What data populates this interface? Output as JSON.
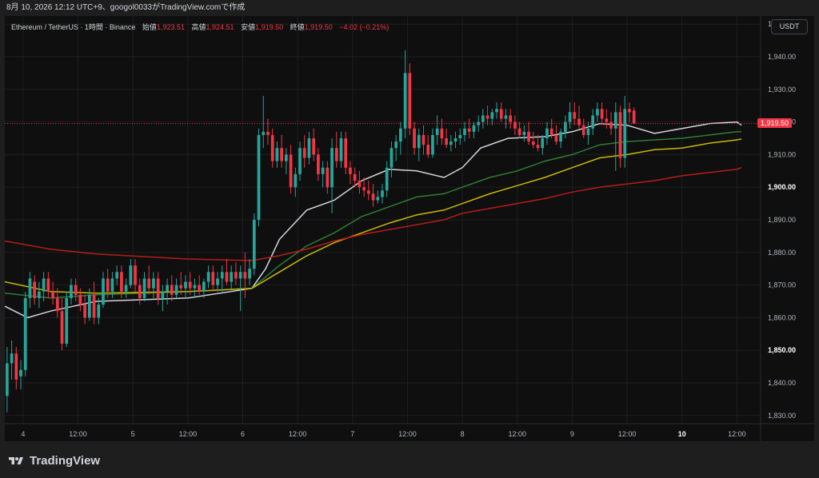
{
  "header": {
    "caption": "8月 10, 2026 12:12 UTC+9、googol0033がTradingView.comで作成"
  },
  "legend": {
    "symbol": "Ethereum / TetherUS · 1時間 · Binance",
    "open_label": "始値",
    "open_value": "1,923.51",
    "high_label": "高値",
    "high_value": "1,924.51",
    "low_label": "安値",
    "low_value": "1,919.50",
    "close_label": "終値",
    "close_value": "1,919.50",
    "change": "−4.02 (−0.21%)"
  },
  "currency_button": "USDT",
  "last_price_tag": "1,919.50",
  "brand": "TradingView",
  "colors": {
    "up": "#26a69a",
    "down": "#f23645",
    "ma_fast": "#d1d4dc",
    "ma_mid": "#2e7d32",
    "ma_slow": "#c9b800",
    "ma_long": "#b71c1c"
  },
  "chart_data": {
    "type": "candlestick",
    "y_tick_labels": [
      "1,950.00",
      "1,940.00",
      "1,930.00",
      "1,920.00",
      "1,910.00",
      "1,900.00",
      "1,890.00",
      "1,880.00",
      "1,870.00",
      "1,860.00",
      "1,850.00",
      "1,840.00",
      "1,830.00"
    ],
    "y_ticks": [
      1950,
      1940,
      1930,
      1920,
      1910,
      1900,
      1890,
      1880,
      1870,
      1860,
      1850,
      1840,
      1830
    ],
    "ylim": [
      1827.5,
      1952.5
    ],
    "x_tick_labels": [
      "4",
      "12:00",
      "5",
      "12:00",
      "6",
      "12:00",
      "7",
      "12:00",
      "8",
      "12:00",
      "9",
      "12:00",
      "10",
      "12:00"
    ],
    "x_ticks": [
      4,
      16,
      28,
      40,
      52,
      64,
      76,
      88,
      100,
      112,
      124,
      136,
      148,
      160
    ],
    "xlim": [
      0,
      165
    ],
    "last_price": 1919.5,
    "moving_averages": [
      {
        "color": "#d1d4dc",
        "points": [
          [
            0,
            1863.5
          ],
          [
            5,
            1860
          ],
          [
            10,
            1862
          ],
          [
            20,
            1865
          ],
          [
            40,
            1866
          ],
          [
            54,
            1869
          ],
          [
            57,
            1875
          ],
          [
            60,
            1884
          ],
          [
            66,
            1893
          ],
          [
            72,
            1896
          ],
          [
            78,
            1902
          ],
          [
            84,
            1905.5
          ],
          [
            90,
            1905
          ],
          [
            96,
            1903
          ],
          [
            100,
            1906
          ],
          [
            104,
            1912
          ],
          [
            110,
            1915
          ],
          [
            118,
            1915.5
          ],
          [
            124,
            1917
          ],
          [
            130,
            1919.5
          ],
          [
            136,
            1919
          ],
          [
            142,
            1916.5
          ],
          [
            148,
            1918
          ],
          [
            154,
            1919.5
          ],
          [
            160,
            1920
          ],
          [
            161,
            1919
          ]
        ]
      },
      {
        "color": "#2e7d32",
        "points": [
          [
            0,
            1867.5
          ],
          [
            10,
            1866
          ],
          [
            20,
            1867
          ],
          [
            40,
            1868
          ],
          [
            54,
            1869
          ],
          [
            60,
            1876
          ],
          [
            66,
            1882
          ],
          [
            72,
            1886
          ],
          [
            78,
            1891
          ],
          [
            84,
            1894
          ],
          [
            90,
            1897
          ],
          [
            96,
            1898
          ],
          [
            100,
            1900
          ],
          [
            106,
            1903
          ],
          [
            112,
            1905
          ],
          [
            118,
            1908
          ],
          [
            124,
            1910
          ],
          [
            130,
            1913
          ],
          [
            136,
            1914
          ],
          [
            142,
            1914.5
          ],
          [
            148,
            1915
          ],
          [
            154,
            1916
          ],
          [
            160,
            1917
          ],
          [
            161,
            1917
          ]
        ]
      },
      {
        "color": "#c9b800",
        "points": [
          [
            0,
            1871
          ],
          [
            10,
            1868
          ],
          [
            20,
            1867.5
          ],
          [
            40,
            1868
          ],
          [
            54,
            1869
          ],
          [
            60,
            1874
          ],
          [
            66,
            1879
          ],
          [
            72,
            1883
          ],
          [
            78,
            1886
          ],
          [
            84,
            1889
          ],
          [
            90,
            1891.5
          ],
          [
            96,
            1893
          ],
          [
            100,
            1895
          ],
          [
            106,
            1898
          ],
          [
            112,
            1900.5
          ],
          [
            118,
            1903
          ],
          [
            124,
            1906
          ],
          [
            130,
            1909
          ],
          [
            136,
            1910
          ],
          [
            142,
            1911.5
          ],
          [
            148,
            1912
          ],
          [
            154,
            1913.5
          ],
          [
            160,
            1914.5
          ],
          [
            161,
            1914.8
          ]
        ]
      },
      {
        "color": "#b71c1c",
        "points": [
          [
            0,
            1883.5
          ],
          [
            10,
            1881
          ],
          [
            20,
            1879.5
          ],
          [
            40,
            1878
          ],
          [
            54,
            1877.5
          ],
          [
            60,
            1879
          ],
          [
            66,
            1881
          ],
          [
            72,
            1883.5
          ],
          [
            78,
            1885.5
          ],
          [
            84,
            1887
          ],
          [
            90,
            1888.5
          ],
          [
            96,
            1890
          ],
          [
            100,
            1892
          ],
          [
            106,
            1893.5
          ],
          [
            112,
            1895
          ],
          [
            118,
            1896.5
          ],
          [
            124,
            1898.5
          ],
          [
            130,
            1900
          ],
          [
            136,
            1901
          ],
          [
            142,
            1902
          ],
          [
            148,
            1903.5
          ],
          [
            154,
            1904.5
          ],
          [
            160,
            1905.5
          ],
          [
            161,
            1906
          ]
        ]
      }
    ],
    "candles": [
      [
        0,
        1836,
        1851,
        1831,
        1846
      ],
      [
        1,
        1846,
        1853,
        1841,
        1849
      ],
      [
        2,
        1849,
        1851,
        1838,
        1841
      ],
      [
        3,
        1842,
        1847,
        1838,
        1844
      ],
      [
        4,
        1844,
        1868,
        1842,
        1866
      ],
      [
        5,
        1866,
        1874,
        1863,
        1872
      ],
      [
        6,
        1871,
        1873,
        1864,
        1866
      ],
      [
        7,
        1866,
        1871,
        1863,
        1868
      ],
      [
        8,
        1868,
        1874,
        1865,
        1872
      ],
      [
        9,
        1872,
        1874,
        1866,
        1868
      ],
      [
        10,
        1868,
        1871,
        1864,
        1866
      ],
      [
        11,
        1866,
        1869,
        1860,
        1862
      ],
      [
        12,
        1862,
        1866,
        1850,
        1852
      ],
      [
        13,
        1852,
        1868,
        1851,
        1866
      ],
      [
        14,
        1866,
        1872,
        1864,
        1870
      ],
      [
        15,
        1870,
        1872,
        1865,
        1867
      ],
      [
        16,
        1867,
        1869,
        1862,
        1864
      ],
      [
        17,
        1864,
        1867,
        1858,
        1860
      ],
      [
        18,
        1860,
        1869,
        1859,
        1867
      ],
      [
        19,
        1867,
        1871,
        1858,
        1860
      ],
      [
        20,
        1860,
        1866,
        1858,
        1864
      ],
      [
        21,
        1864,
        1874,
        1863,
        1872
      ],
      [
        22,
        1872,
        1875,
        1866,
        1868
      ],
      [
        23,
        1868,
        1874,
        1866,
        1872
      ],
      [
        24,
        1872,
        1876,
        1870,
        1874
      ],
      [
        25,
        1874,
        1876,
        1866,
        1868
      ],
      [
        26,
        1868,
        1872,
        1866,
        1870
      ],
      [
        27,
        1870,
        1878,
        1869,
        1876
      ],
      [
        28,
        1876,
        1878,
        1868,
        1870
      ],
      [
        29,
        1870,
        1872,
        1864,
        1866
      ],
      [
        30,
        1866,
        1874,
        1865,
        1872
      ],
      [
        31,
        1872,
        1876,
        1867,
        1869
      ],
      [
        32,
        1869,
        1874,
        1866,
        1872
      ],
      [
        33,
        1872,
        1874,
        1864,
        1866
      ],
      [
        34,
        1866,
        1870,
        1862,
        1868
      ],
      [
        35,
        1868,
        1872,
        1864,
        1870
      ],
      [
        36,
        1870,
        1873,
        1865,
        1867
      ],
      [
        37,
        1867,
        1872,
        1866,
        1870
      ],
      [
        38,
        1870,
        1874,
        1867,
        1869
      ],
      [
        39,
        1869,
        1873,
        1866,
        1871
      ],
      [
        40,
        1871,
        1874,
        1867,
        1869
      ],
      [
        41,
        1869,
        1872,
        1866,
        1870
      ],
      [
        42,
        1870,
        1873,
        1867,
        1868
      ],
      [
        43,
        1868,
        1872,
        1866,
        1871
      ],
      [
        44,
        1871,
        1876,
        1869,
        1874
      ],
      [
        45,
        1874,
        1876,
        1868,
        1870
      ],
      [
        46,
        1870,
        1874,
        1868,
        1872
      ],
      [
        47,
        1872,
        1876,
        1868,
        1874
      ],
      [
        48,
        1874,
        1878,
        1870,
        1871
      ],
      [
        49,
        1871,
        1876,
        1868,
        1874
      ],
      [
        50,
        1874,
        1877,
        1870,
        1872
      ],
      [
        51,
        1872,
        1876,
        1862,
        1874
      ],
      [
        52,
        1874,
        1880,
        1866,
        1872
      ],
      [
        53,
        1872,
        1878,
        1870,
        1875
      ],
      [
        54,
        1875,
        1892,
        1873,
        1890
      ],
      [
        55,
        1890,
        1918,
        1888,
        1916
      ],
      [
        56,
        1916,
        1928,
        1912,
        1917
      ],
      [
        57,
        1917,
        1921,
        1913,
        1916
      ],
      [
        58,
        1916,
        1918,
        1906,
        1908
      ],
      [
        59,
        1908,
        1914,
        1906,
        1912
      ],
      [
        60,
        1912,
        1916,
        1906,
        1908
      ],
      [
        61,
        1908,
        1912,
        1904,
        1910
      ],
      [
        62,
        1910,
        1913,
        1898,
        1900
      ],
      [
        63,
        1900,
        1906,
        1897,
        1904
      ],
      [
        64,
        1904,
        1914,
        1902,
        1912
      ],
      [
        65,
        1912,
        1916,
        1906,
        1909
      ],
      [
        66,
        1909,
        1917,
        1907,
        1915
      ],
      [
        67,
        1915,
        1918,
        1908,
        1910
      ],
      [
        68,
        1910,
        1912,
        1902,
        1904
      ],
      [
        69,
        1904,
        1908,
        1900,
        1906
      ],
      [
        70,
        1906,
        1908,
        1898,
        1900
      ],
      [
        71,
        1900,
        1915,
        1892,
        1912
      ],
      [
        72,
        1912,
        1917,
        1906,
        1908
      ],
      [
        73,
        1908,
        1917,
        1906,
        1915
      ],
      [
        74,
        1915,
        1917,
        1904,
        1906
      ],
      [
        75,
        1906,
        1908,
        1901,
        1904
      ],
      [
        76,
        1904,
        1906,
        1900,
        1902
      ],
      [
        77,
        1902,
        1905,
        1898,
        1900
      ],
      [
        78,
        1900,
        1903,
        1897,
        1899
      ],
      [
        79,
        1899,
        1902,
        1896,
        1898
      ],
      [
        80,
        1898,
        1901,
        1894,
        1896
      ],
      [
        81,
        1896,
        1899,
        1895,
        1897
      ],
      [
        82,
        1897,
        1901,
        1895,
        1899
      ],
      [
        83,
        1899,
        1908,
        1897,
        1906
      ],
      [
        84,
        1906,
        1914,
        1903,
        1912
      ],
      [
        85,
        1912,
        1916,
        1908,
        1914
      ],
      [
        86,
        1914,
        1920,
        1910,
        1918
      ],
      [
        87,
        1918,
        1942,
        1915,
        1935
      ],
      [
        88,
        1935,
        1938,
        1916,
        1918
      ],
      [
        89,
        1918,
        1920,
        1910,
        1912
      ],
      [
        90,
        1912,
        1918,
        1908,
        1916
      ],
      [
        91,
        1916,
        1919,
        1910,
        1913
      ],
      [
        92,
        1913,
        1916,
        1909,
        1910
      ],
      [
        93,
        1910,
        1918,
        1909,
        1916
      ],
      [
        94,
        1916,
        1922,
        1913,
        1918
      ],
      [
        95,
        1918,
        1921,
        1913,
        1915
      ],
      [
        96,
        1915,
        1918,
        1912,
        1913
      ],
      [
        97,
        1913,
        1916,
        1911,
        1914
      ],
      [
        98,
        1914,
        1917,
        1912,
        1915
      ],
      [
        99,
        1915,
        1918,
        1913,
        1916
      ],
      [
        100,
        1916,
        1920,
        1914,
        1918
      ],
      [
        101,
        1918,
        1921,
        1915,
        1917
      ],
      [
        102,
        1917,
        1920,
        1915,
        1919
      ],
      [
        103,
        1919,
        1922,
        1917,
        1920
      ],
      [
        104,
        1920,
        1924,
        1918,
        1922
      ],
      [
        105,
        1922,
        1925,
        1919,
        1921
      ],
      [
        106,
        1921,
        1924,
        1919,
        1923
      ],
      [
        107,
        1923,
        1926,
        1921,
        1924
      ],
      [
        108,
        1924,
        1926,
        1920,
        1921
      ],
      [
        109,
        1921,
        1924,
        1918,
        1922
      ],
      [
        110,
        1922,
        1924,
        1918,
        1920
      ],
      [
        111,
        1920,
        1922,
        1916,
        1918
      ],
      [
        112,
        1918,
        1920,
        1915,
        1916
      ],
      [
        113,
        1916,
        1919,
        1914,
        1917
      ],
      [
        114,
        1917,
        1920,
        1913,
        1914
      ],
      [
        115,
        1914,
        1917,
        1912,
        1913
      ],
      [
        116,
        1913,
        1916,
        1911,
        1912
      ],
      [
        117,
        1912,
        1916,
        1910,
        1915
      ],
      [
        118,
        1915,
        1920,
        1913,
        1918
      ],
      [
        119,
        1918,
        1921,
        1915,
        1916
      ],
      [
        120,
        1916,
        1919,
        1913,
        1914
      ],
      [
        121,
        1914,
        1918,
        1912,
        1917
      ],
      [
        122,
        1917,
        1922,
        1915,
        1920
      ],
      [
        123,
        1920,
        1926,
        1918,
        1923
      ],
      [
        124,
        1923,
        1926,
        1919,
        1921
      ],
      [
        125,
        1921,
        1925,
        1918,
        1919
      ],
      [
        126,
        1919,
        1921,
        1915,
        1916
      ],
      [
        127,
        1916,
        1920,
        1913,
        1918
      ],
      [
        128,
        1918,
        1924,
        1916,
        1922
      ],
      [
        129,
        1922,
        1926,
        1920,
        1924
      ],
      [
        130,
        1924,
        1926,
        1919,
        1921
      ],
      [
        131,
        1921,
        1924,
        1918,
        1920
      ],
      [
        132,
        1920,
        1923,
        1916,
        1918
      ],
      [
        133,
        1918,
        1926,
        1905,
        1923
      ],
      [
        134,
        1923,
        1925,
        1906,
        1909
      ],
      [
        135,
        1909,
        1928,
        1906,
        1924
      ],
      [
        136,
        1924,
        1926,
        1920,
        1923
      ],
      [
        137,
        1923.51,
        1924.51,
        1919.5,
        1919.5
      ]
    ]
  }
}
